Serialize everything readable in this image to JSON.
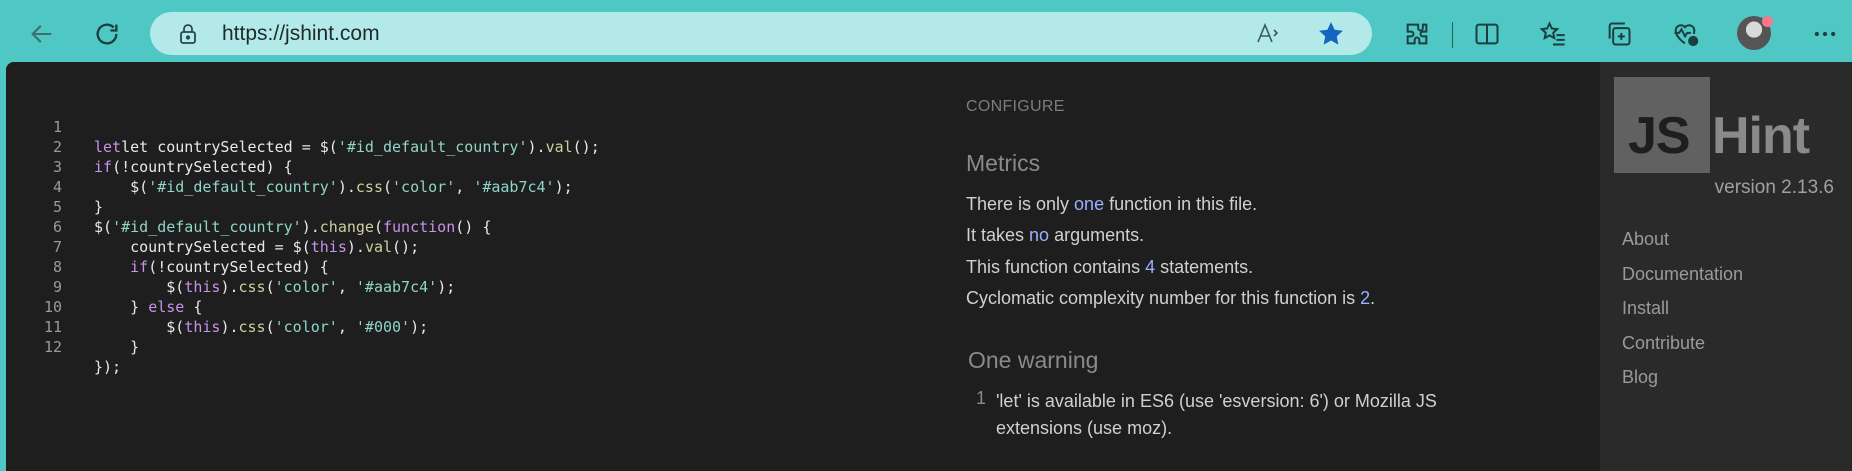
{
  "browser": {
    "url": "https://jshint.com",
    "icons": [
      "back-icon",
      "refresh-icon",
      "lock-icon",
      "read-aloud-icon",
      "favorite-star-icon",
      "extensions-icon",
      "split-screen-icon",
      "favorites-icon",
      "collections-icon",
      "browser-essentials-icon",
      "profile-avatar",
      "more-icon"
    ]
  },
  "editor": {
    "lines": [
      {
        "n": "1"
      },
      {
        "n": "2"
      },
      {
        "n": "3"
      },
      {
        "n": "4"
      },
      {
        "n": "5"
      },
      {
        "n": "6"
      },
      {
        "n": "7"
      },
      {
        "n": "8"
      },
      {
        "n": "9"
      },
      {
        "n": "10"
      },
      {
        "n": "11"
      },
      {
        "n": "12"
      }
    ],
    "code": {
      "l1_a": "let countrySelected = $(",
      "l1_s": "'#id_default_country'",
      "l1_b": ").",
      "l1_f": "val",
      "l1_c": "();",
      "l2_a": "if",
      "l2_b": "(!countrySelected) {",
      "l3_a": "    $(",
      "l3_s1": "'#id_default_country'",
      "l3_b": ").",
      "l3_f": "css",
      "l3_c": "(",
      "l3_s2": "'color'",
      "l3_d": ", ",
      "l3_s3": "'#aab7c4'",
      "l3_e": ");",
      "l4": "}",
      "l5_a": "$(",
      "l5_s": "'#id_default_country'",
      "l5_b": ").",
      "l5_f": "change",
      "l5_c": "(",
      "l5_k": "function",
      "l5_d": "() {",
      "l6_a": "    countrySelected = $(",
      "l6_t": "this",
      "l6_b": ").",
      "l6_f": "val",
      "l6_c": "();",
      "l7_a": "    if",
      "l7_b": "(!countrySelected) {",
      "l8_a": "        $(",
      "l8_t": "this",
      "l8_b": ").",
      "l8_f": "css",
      "l8_c": "(",
      "l8_s1": "'color'",
      "l8_d": ", ",
      "l8_s2": "'#aab7c4'",
      "l8_e": ");",
      "l9_a": "    } ",
      "l9_k": "else",
      "l9_b": " {",
      "l10_a": "        $(",
      "l10_t": "this",
      "l10_b": ").",
      "l10_f": "css",
      "l10_c": "(",
      "l10_s1": "'color'",
      "l10_d": ", ",
      "l10_s2": "'#000'",
      "l10_e": ");",
      "l11": "    }",
      "l12": "});"
    }
  },
  "report": {
    "configure": "CONFIGURE",
    "metrics_heading": "Metrics",
    "m1_a": "There is only ",
    "m1_h": "one",
    "m1_b": " function in this file.",
    "m2_a": "It takes ",
    "m2_h": "no",
    "m2_b": " arguments.",
    "m3_a": "This function contains ",
    "m3_h": "4",
    "m3_b": " statements.",
    "m4_a": "Cyclomatic complexity number for this function is ",
    "m4_h": "2",
    "m4_b": ".",
    "warning_heading": "One warning",
    "warning_number": "1",
    "warning_text": "'let' is available in ES6 (use 'esversion: 6') or Mozilla JS extensions (use moz)."
  },
  "sidebar": {
    "logo_js": "JS",
    "logo_hint": "Hint",
    "version": "version 2.13.6",
    "nav": [
      "About",
      "Documentation",
      "Install",
      "Contribute",
      "Blog"
    ]
  }
}
